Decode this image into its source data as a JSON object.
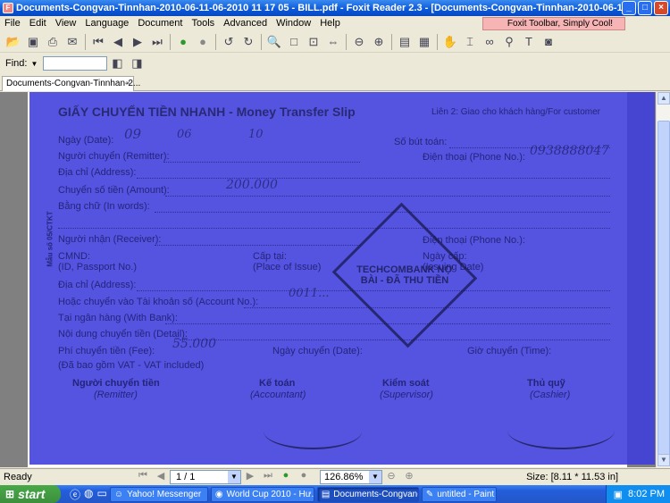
{
  "window": {
    "title": "Documents-Congvan-Tinnhan-2010-06-11-06-2010 11 17 05 - BILL.pdf - Foxit Reader 2.3 - [Documents-Congvan-Tinnhan-2010-06-11-06-2010 11...",
    "minimize": "_",
    "maximize": "□",
    "close": "×"
  },
  "menu": [
    "File",
    "Edit",
    "View",
    "Language",
    "Document",
    "Tools",
    "Advanced",
    "Window",
    "Help"
  ],
  "ad_text": "Foxit Toolbar, Simply Cool!",
  "find": {
    "label": "Find:"
  },
  "tab": {
    "label": "Documents-Congvan-Tinnhan-2...",
    "close": "×"
  },
  "form": {
    "title": "GIẤY CHUYỂN TIỀN NHANH - Money Transfer Slip",
    "copy_note": "Liên 2: Giao cho khách hàng/For customer",
    "side_code": "Mẫu số 05/CTKT",
    "fields": {
      "date": "Ngày (Date):",
      "serial": "Số bút toán:",
      "remitter": "Người chuyển (Remitter):",
      "phone1": "Điện thoại (Phone No.):",
      "address1": "Địa chỉ (Address):",
      "amount": "Chuyển số tiền (Amount):",
      "in_words": "Bằng chữ (In words):",
      "receiver": "Người nhận (Receiver):",
      "phone2": "Điện thoại (Phone No.):",
      "cmnd": "CMND:",
      "passport": "(ID, Passport No.)",
      "issued_at": "Cấp tại:",
      "place_issue": "(Place of Issue)",
      "issued_date": "Ngày cấp:",
      "issuing_date": "(Issuing Date)",
      "address2": "Địa chỉ (Address):",
      "account": "Hoặc chuyển vào Tài khoản số (Account No.):",
      "bank": "Tại ngân hàng (With Bank):",
      "detail": "Nội dung chuyển tiền (Detail):",
      "fee": "Phí chuyển tiền (Fee):",
      "transfer_date": "Ngày chuyển (Date):",
      "time": "Giờ chuyển (Time):",
      "vat": "(Đã bao gồm VAT - VAT included)"
    },
    "signatures": [
      {
        "vi": "Người chuyển tiền",
        "en": "(Remitter)"
      },
      {
        "vi": "Kế toán",
        "en": "(Accountant)"
      },
      {
        "vi": "Kiểm soát",
        "en": "(Supervisor)"
      },
      {
        "vi": "Thủ quỹ",
        "en": "(Cashier)"
      }
    ],
    "handwriting": {
      "day": "09",
      "month": "06",
      "year": "10",
      "phone": "0938888047",
      "amount": "200.000",
      "fee": "55.000",
      "account": "0011..."
    },
    "stamp": "TECHCOMBANK NỢ BÀI - ĐÃ THU TIỀN"
  },
  "status": {
    "ready": "Ready",
    "page": "1 / 1",
    "zoom": "126.86%",
    "size": "Size: [8.11 * 11.53 in]"
  },
  "taskbar": {
    "start": "start",
    "tasks": [
      {
        "label": "Yahoo! Messenger",
        "icon": "☺"
      },
      {
        "label": "World Cup 2010 - Hư...",
        "icon": "◉"
      },
      {
        "label": "Documents-Congvan-...",
        "icon": "▤"
      },
      {
        "label": "untitled - Paint",
        "icon": "✎"
      }
    ],
    "clock": "8:02 PM"
  }
}
